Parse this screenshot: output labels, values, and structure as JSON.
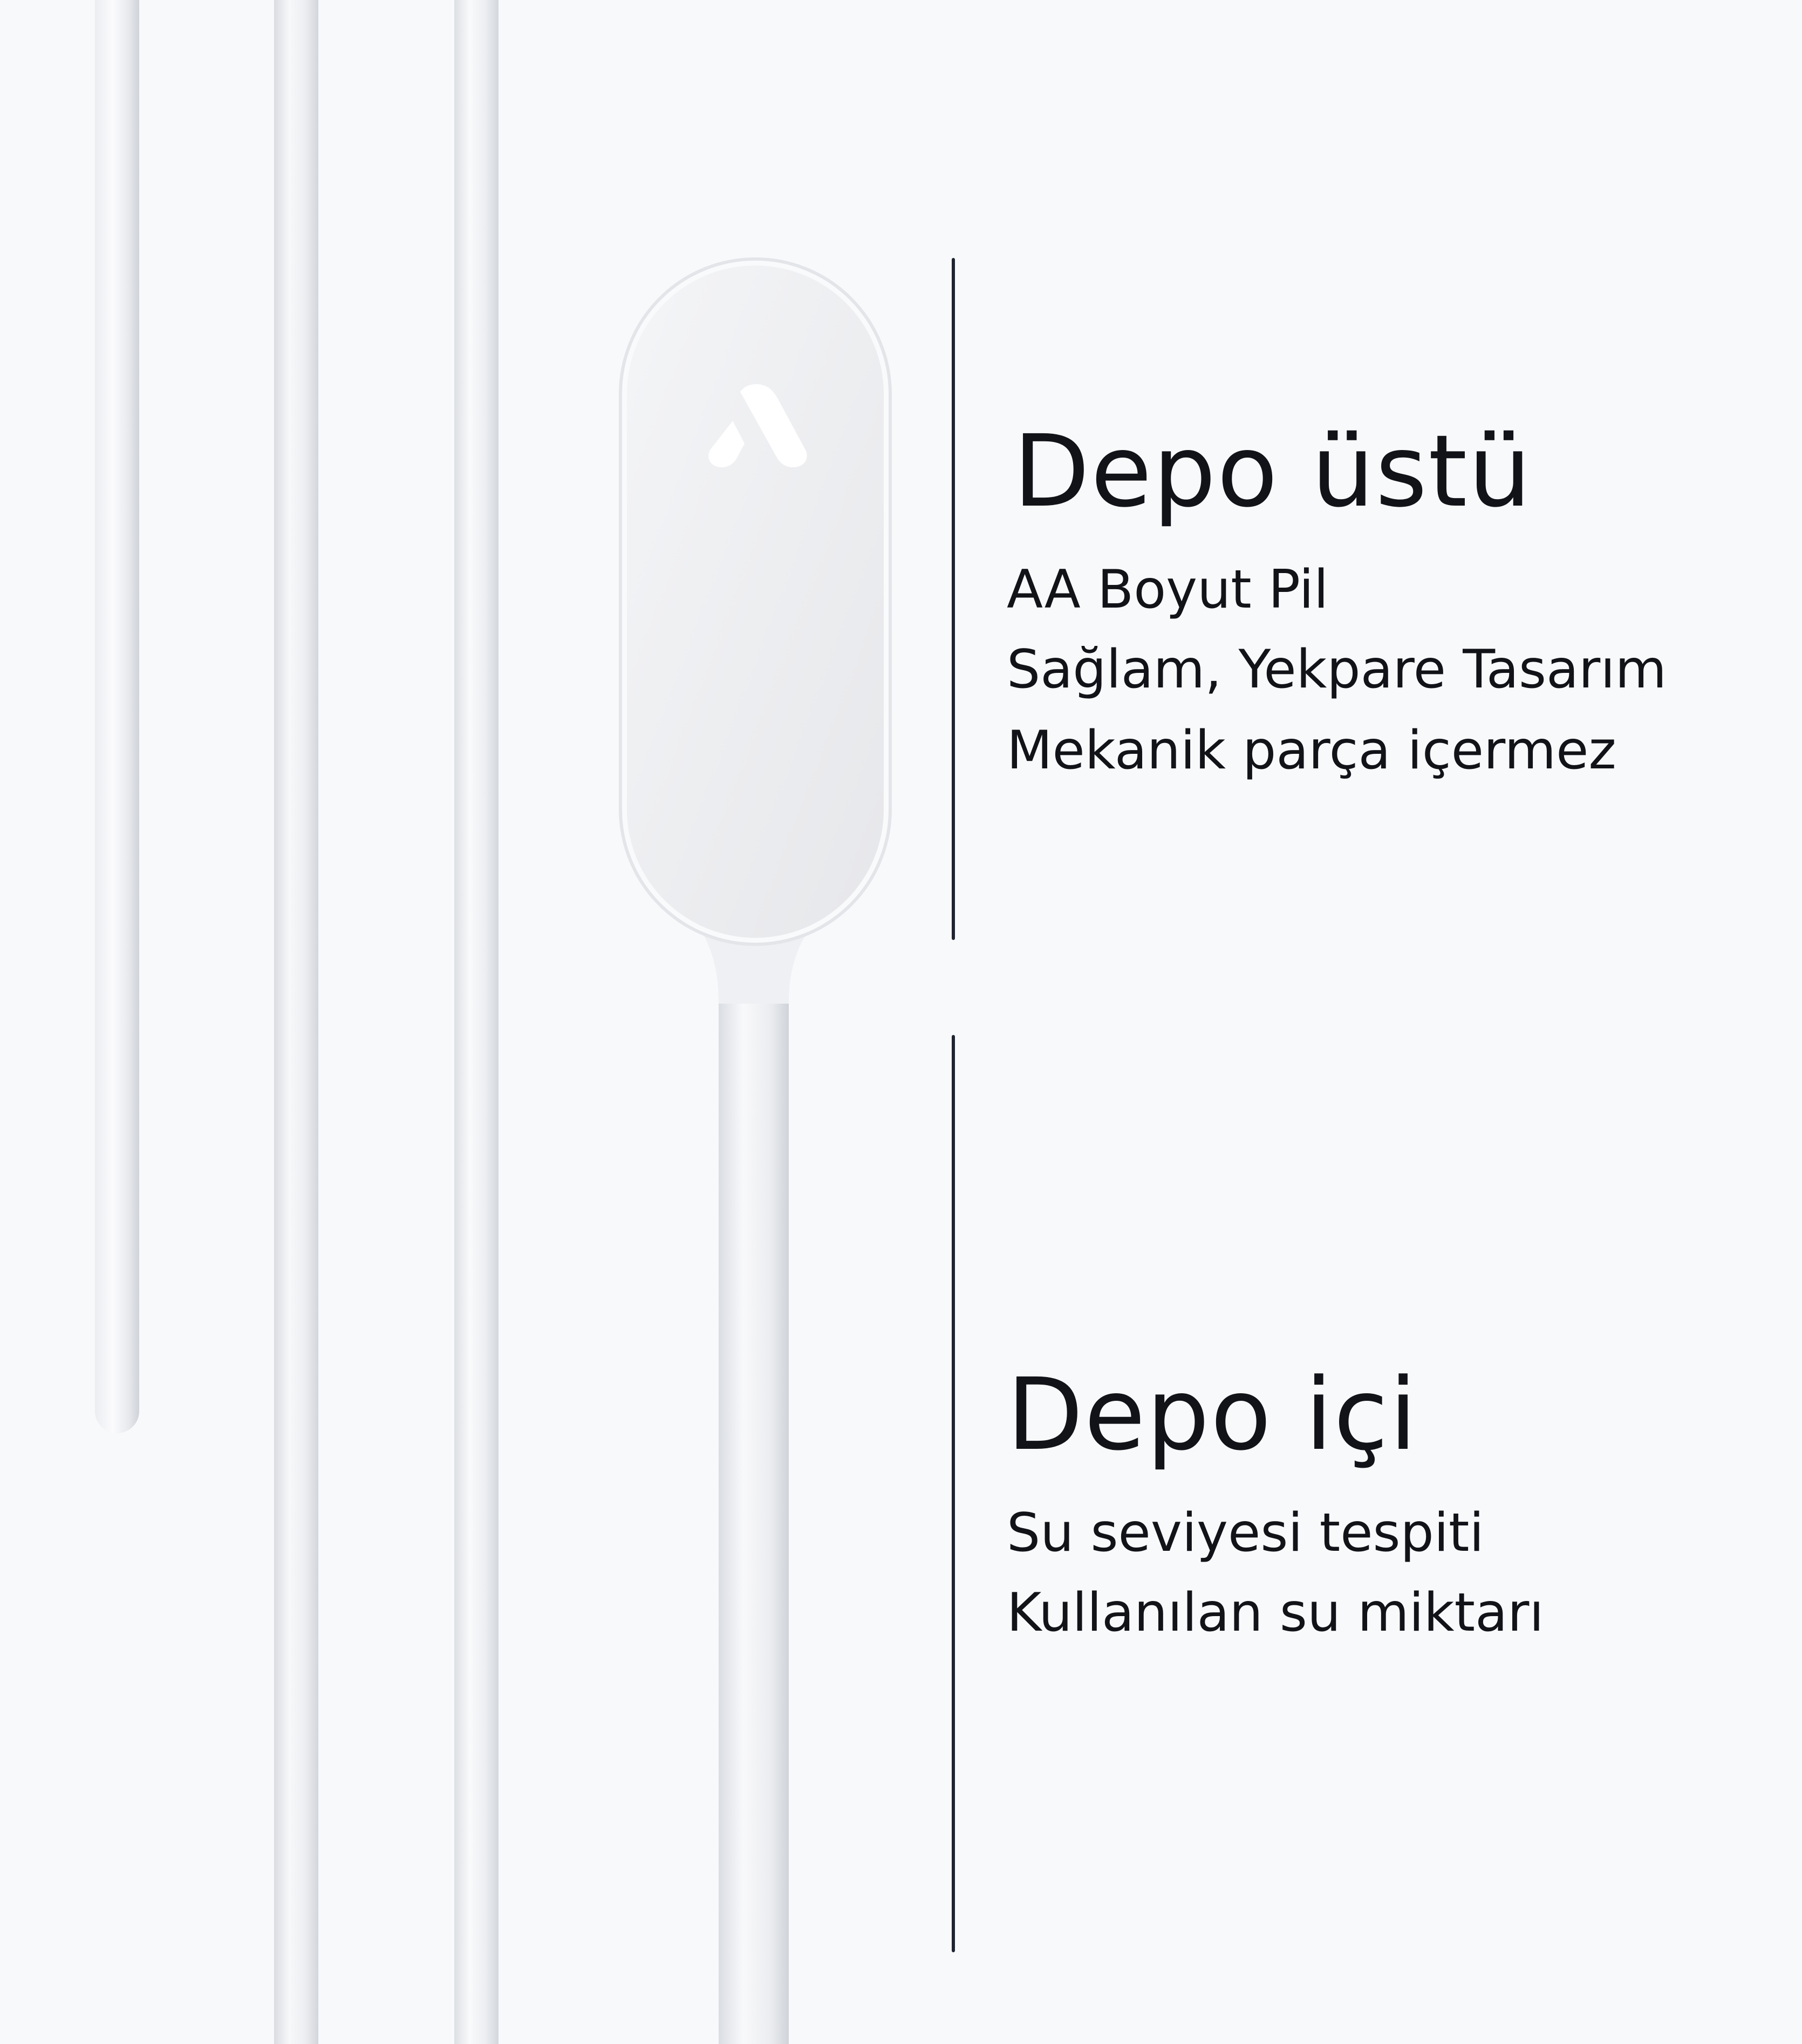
{
  "top_section": {
    "title": "Depo üstü",
    "features": [
      "AA Boyut Pil",
      "Sağlam, Yekpare Tasarım",
      "Mekanik parça içermez"
    ]
  },
  "bottom_section": {
    "title": "Depo içi",
    "features": [
      "Su seviyesi tespiti",
      "Kullanılan su miktarı"
    ]
  },
  "colors": {
    "background": "#f8f9fb",
    "text": "#111318",
    "divider": "#1f2430",
    "sensor_body": "#ececee"
  },
  "icons": [
    "logo-icon"
  ]
}
